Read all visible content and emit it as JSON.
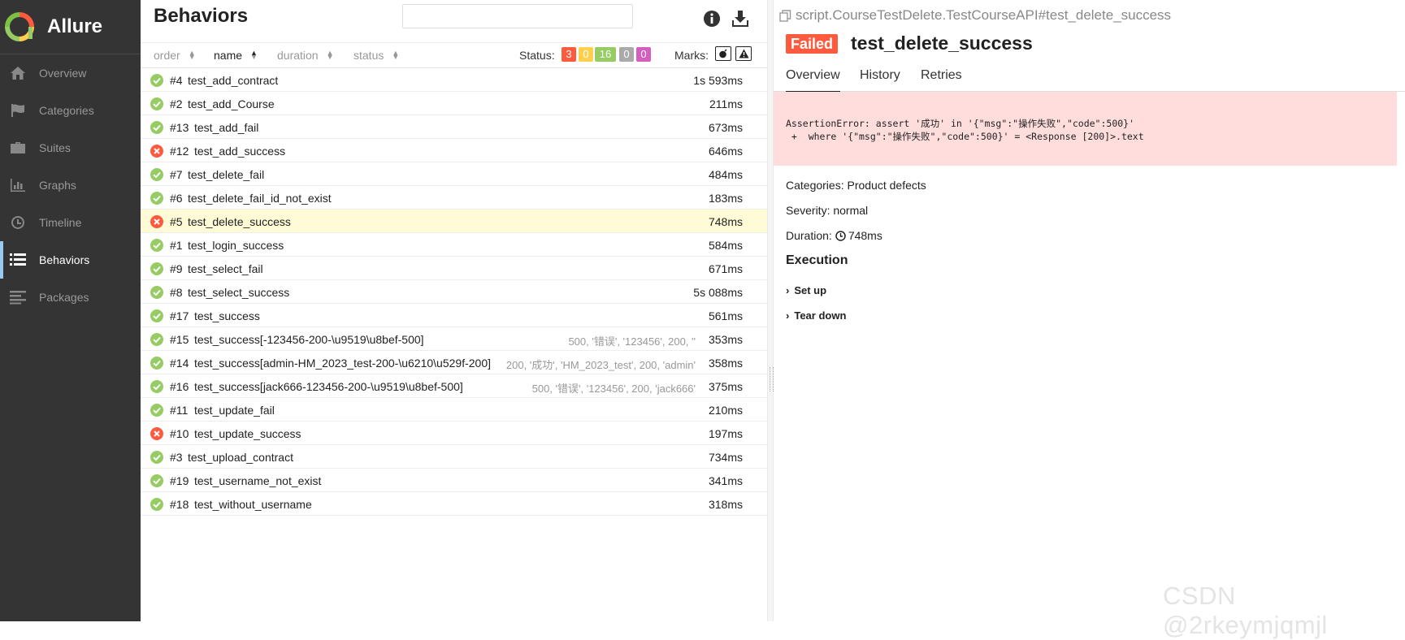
{
  "app": {
    "name": "Allure"
  },
  "sidebar": {
    "items": [
      {
        "label": "Overview",
        "icon": "home-icon"
      },
      {
        "label": "Categories",
        "icon": "flag-icon"
      },
      {
        "label": "Suites",
        "icon": "briefcase-icon"
      },
      {
        "label": "Graphs",
        "icon": "bar-chart-icon"
      },
      {
        "label": "Timeline",
        "icon": "clock-icon"
      },
      {
        "label": "Behaviors",
        "icon": "list-icon",
        "active": true
      },
      {
        "label": "Packages",
        "icon": "align-left-icon"
      }
    ]
  },
  "list": {
    "title": "Behaviors",
    "search": {
      "value": "",
      "placeholder": ""
    },
    "sort": {
      "order": "order",
      "name": "name",
      "duration": "duration",
      "status": "status"
    },
    "status_label": "Status:",
    "status_counts": {
      "failed": "3",
      "broken": "0",
      "passed": "16",
      "skipped": "0",
      "unknown": "0"
    },
    "marks_label": "Marks:",
    "colors": {
      "passed": "#97cc64",
      "failed": "#fd5a3e",
      "broken": "#ffd050",
      "skipped": "#aaaaaa",
      "unknown": "#d35ebe",
      "selected_row": "#fffbd6"
    },
    "rows": [
      {
        "num": "#4",
        "name": "test_add_contract",
        "params": "",
        "duration": "1s 593ms",
        "status": "passed"
      },
      {
        "num": "#2",
        "name": "test_add_Course",
        "params": "",
        "duration": "211ms",
        "status": "passed"
      },
      {
        "num": "#13",
        "name": "test_add_fail",
        "params": "",
        "duration": "673ms",
        "status": "passed"
      },
      {
        "num": "#12",
        "name": "test_add_success",
        "params": "",
        "duration": "646ms",
        "status": "failed"
      },
      {
        "num": "#7",
        "name": "test_delete_fail",
        "params": "",
        "duration": "484ms",
        "status": "passed"
      },
      {
        "num": "#6",
        "name": "test_delete_fail_id_not_exist",
        "params": "",
        "duration": "183ms",
        "status": "passed"
      },
      {
        "num": "#5",
        "name": "test_delete_success",
        "params": "",
        "duration": "748ms",
        "status": "failed",
        "selected": true
      },
      {
        "num": "#1",
        "name": "test_login_success",
        "params": "",
        "duration": "584ms",
        "status": "passed"
      },
      {
        "num": "#9",
        "name": "test_select_fail",
        "params": "",
        "duration": "671ms",
        "status": "passed"
      },
      {
        "num": "#8",
        "name": "test_select_success",
        "params": "",
        "duration": "5s 088ms",
        "status": "passed"
      },
      {
        "num": "#17",
        "name": "test_success",
        "params": "",
        "duration": "561ms",
        "status": "passed"
      },
      {
        "num": "#15",
        "name": "test_success[-123456-200-\\u9519\\u8bef-500]",
        "params": "500, '错误', '123456', 200, ''",
        "duration": "353ms",
        "status": "passed"
      },
      {
        "num": "#14",
        "name": "test_success[admin-HM_2023_test-200-\\u6210\\u529f-200]",
        "params": "200, '成功', 'HM_2023_test', 200, 'admin'",
        "duration": "358ms",
        "status": "passed"
      },
      {
        "num": "#16",
        "name": "test_success[jack666-123456-200-\\u9519\\u8bef-500]",
        "params": "500, '错误', '123456', 200, 'jack666'",
        "duration": "375ms",
        "status": "passed"
      },
      {
        "num": "#11",
        "name": "test_update_fail",
        "params": "",
        "duration": "210ms",
        "status": "passed"
      },
      {
        "num": "#10",
        "name": "test_update_success",
        "params": "",
        "duration": "197ms",
        "status": "failed"
      },
      {
        "num": "#3",
        "name": "test_upload_contract",
        "params": "",
        "duration": "734ms",
        "status": "passed"
      },
      {
        "num": "#19",
        "name": "test_username_not_exist",
        "params": "",
        "duration": "341ms",
        "status": "passed"
      },
      {
        "num": "#18",
        "name": "test_without_username",
        "params": "",
        "duration": "318ms",
        "status": "passed"
      }
    ]
  },
  "detail": {
    "path": "script.CourseTestDelete.TestCourseAPI#test_delete_success",
    "status_badge": "Failed",
    "title": "test_delete_success",
    "tabs": [
      "Overview",
      "History",
      "Retries"
    ],
    "error_line1": "AssertionError: assert '成功' in '{\"msg\":\"操作失败\",\"code\":500}'",
    "error_line2": " +  where '{\"msg\":\"操作失败\",\"code\":500}' = <Response [200]>.text",
    "categories": "Categories: Product defects",
    "severity": "Severity: normal",
    "duration_label": "Duration:",
    "duration_value": "748ms",
    "execution_title": "Execution",
    "steps": [
      "Set up",
      "Tear down"
    ]
  },
  "watermark": "CSDN @2rkeymjqmjl"
}
